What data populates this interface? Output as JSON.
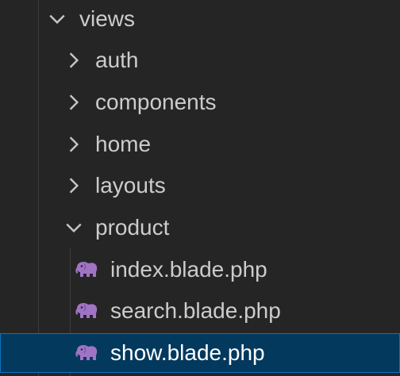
{
  "tree": {
    "views": {
      "label": "views",
      "expanded": true,
      "chevron_icon": "chevron-down-icon"
    },
    "folders": [
      {
        "label": "auth",
        "expanded": false,
        "chevron_icon": "chevron-right-icon"
      },
      {
        "label": "components",
        "expanded": false,
        "chevron_icon": "chevron-right-icon"
      },
      {
        "label": "home",
        "expanded": false,
        "chevron_icon": "chevron-right-icon"
      },
      {
        "label": "layouts",
        "expanded": false,
        "chevron_icon": "chevron-right-icon"
      },
      {
        "label": "product",
        "expanded": true,
        "chevron_icon": "chevron-down-icon"
      }
    ],
    "files": [
      {
        "label": "index.blade.php",
        "icon": "php-elephant-icon",
        "selected": false
      },
      {
        "label": "search.blade.php",
        "icon": "php-elephant-icon",
        "selected": false
      },
      {
        "label": "show.blade.php",
        "icon": "php-elephant-icon",
        "selected": true
      }
    ]
  },
  "colors": {
    "background": "#252526",
    "text": "#cccccc",
    "selection_background": "#04395e",
    "selection_border": "#0a72c4",
    "php_icon": "#a074c4"
  }
}
